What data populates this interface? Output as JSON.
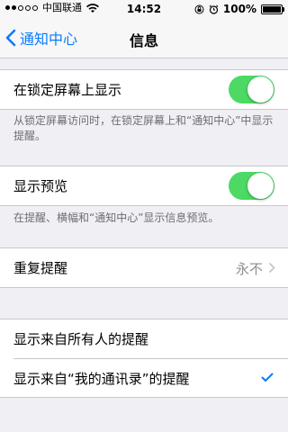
{
  "status_bar": {
    "carrier": "中国联通",
    "time": "14:52",
    "battery_percent": "100%",
    "signal_bars_filled": 2,
    "battery_level": 1.0
  },
  "nav": {
    "back_label": "通知中心",
    "title": "信息"
  },
  "lock_screen": {
    "label": "在锁定屏幕上显示",
    "enabled": true,
    "footer": "从锁定屏幕访问时，在锁定屏幕上和“通知中心”中显示提醒。"
  },
  "preview": {
    "label": "显示预览",
    "enabled": true,
    "footer": "在提醒、横幅和“通知中心”显示信息预览。"
  },
  "repeat": {
    "label": "重复提醒",
    "value": "永不"
  },
  "sources": {
    "items": [
      {
        "label": "显示来自所有人的提醒",
        "checked": false
      },
      {
        "label": "显示来自“我的通讯录”的提醒",
        "checked": true
      }
    ]
  },
  "colors": {
    "accent": "#0a7aff",
    "toggle_on": "#4cd964",
    "background": "#efeff4",
    "footer_text": "#6d6d72"
  },
  "icons": {
    "back": "chevron-left-icon",
    "wifi": "wifi-icon",
    "lock": "rotation-lock-icon",
    "alarm": "alarm-icon",
    "battery": "battery-icon",
    "disclosure": "chevron-right-icon",
    "checkmark": "checkmark-icon"
  }
}
